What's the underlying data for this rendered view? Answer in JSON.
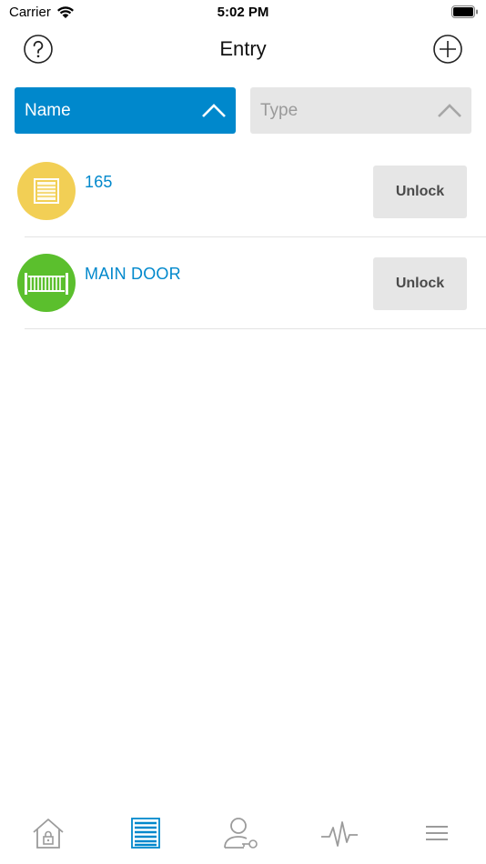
{
  "status_bar": {
    "carrier": "Carrier",
    "time": "5:02 PM"
  },
  "nav": {
    "title": "Entry",
    "left_icon": "help-circle-icon",
    "right_icon": "add-circle-icon"
  },
  "sort": {
    "name_label": "Name",
    "type_label": "Type",
    "active": "name"
  },
  "entries": [
    {
      "name": "165",
      "icon": "garage-door-icon",
      "icon_color": "#f2cf55",
      "button_label": "Unlock"
    },
    {
      "name": "MAIN DOOR",
      "icon": "gate-icon",
      "icon_color": "#5bbf2d",
      "button_label": "Unlock"
    }
  ],
  "tabs": [
    {
      "name": "home",
      "icon": "home-lock-icon",
      "active": false
    },
    {
      "name": "entry",
      "icon": "entry-door-icon",
      "active": true
    },
    {
      "name": "users",
      "icon": "user-key-icon",
      "active": false
    },
    {
      "name": "activity",
      "icon": "activity-pulse-icon",
      "active": false
    },
    {
      "name": "menu",
      "icon": "menu-lines-icon",
      "active": false
    }
  ],
  "colors": {
    "accent": "#0088cc",
    "inactive_tab": "#9b9b9b",
    "button_bg": "#e6e6e6"
  }
}
